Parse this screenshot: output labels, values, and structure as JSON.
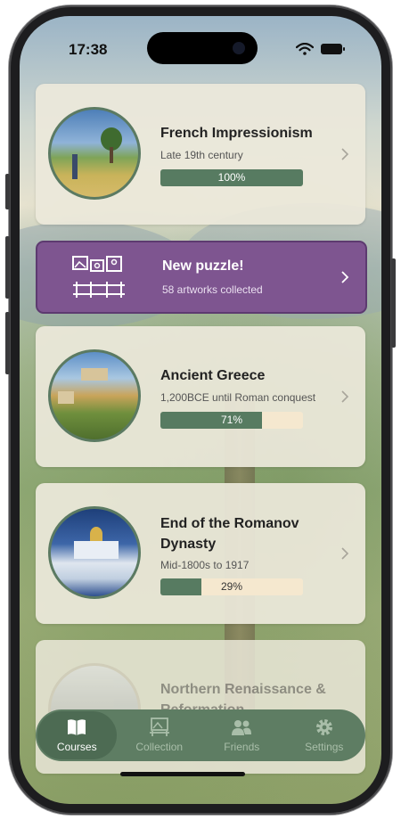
{
  "status_bar": {
    "time": "17:38"
  },
  "courses": [
    {
      "title": "French Impressionism",
      "subtitle": "Late 19th century",
      "progress": 100,
      "progress_label": "100%"
    },
    {
      "title": "Ancient Greece",
      "subtitle": "1,200BCE until Roman conquest",
      "progress": 71,
      "progress_label": "71%"
    },
    {
      "title": "End of the Romanov Dynasty",
      "subtitle": "Mid-1800s to 1917",
      "progress": 29,
      "progress_label": "29%"
    },
    {
      "title": "Northern Renaissance & Reformation"
    }
  ],
  "puzzle": {
    "title": "New puzzle!",
    "subtitle": "58 artworks collected"
  },
  "tabs": [
    {
      "label": "Courses",
      "icon": "book-icon",
      "active": true
    },
    {
      "label": "Collection",
      "icon": "collection-icon",
      "active": false
    },
    {
      "label": "Friends",
      "icon": "friends-icon",
      "active": false
    },
    {
      "label": "Settings",
      "icon": "gear-icon",
      "active": false
    }
  ],
  "colors": {
    "accent_green": "#577b61",
    "puzzle_purple": "#7e5590",
    "progress_track": "#f5e8cf"
  }
}
